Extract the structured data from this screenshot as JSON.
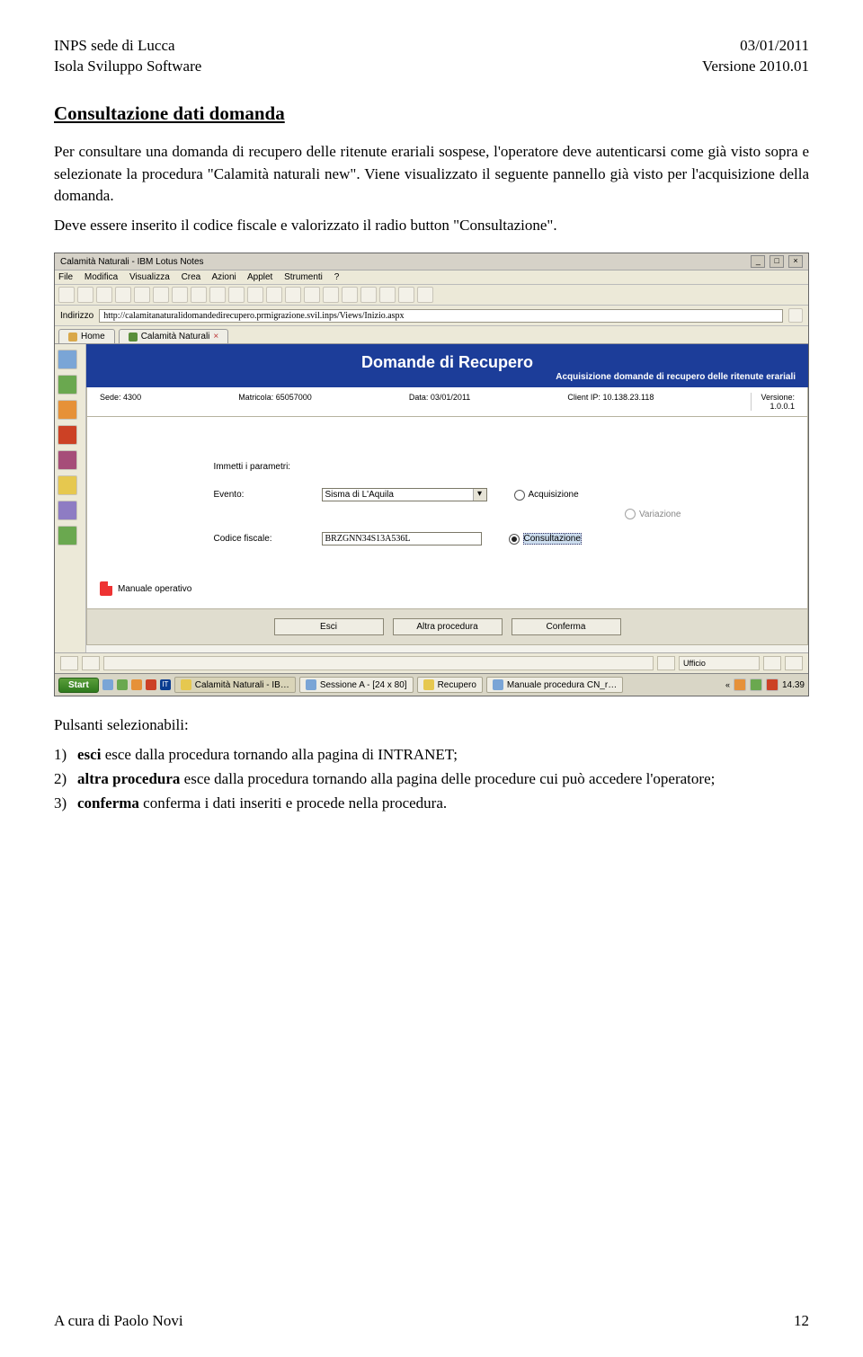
{
  "header": {
    "left1": "INPS sede di Lucca",
    "left2": "Isola Sviluppo Software",
    "right1": "03/01/2011",
    "right2": "Versione 2010.01"
  },
  "title": "Consultazione dati domanda",
  "para1": "Per consultare una domanda di recupero delle ritenute erariali sospese, l'operatore deve autenticarsi come già visto sopra e selezionate la procedura \"Calamità naturali new\". Viene visualizzato il seguente pannello già visto per l'acquisizione della domanda.",
  "para2": "Deve essere inserito il codice fiscale e valorizzato il radio button \"Consultazione\".",
  "lotus": {
    "title": "Calamità Naturali - IBM Lotus Notes",
    "menu": [
      "File",
      "Modifica",
      "Visualizza",
      "Crea",
      "Azioni",
      "Applet",
      "Strumenti",
      "?"
    ],
    "addr_label": "Indirizzo",
    "addr_value": "http://calamitanaturalidomandedirecupero.prmigrazione.svil.inps/Views/Inizio.aspx",
    "tabs": {
      "home": "Home",
      "main": "Calamità Naturali"
    },
    "banner_title": "Domande di Recupero",
    "banner_sub": "Acquisizione domande di recupero delle ritenute erariali",
    "info": {
      "sede_l": "Sede:",
      "sede_v": "4300",
      "matr_l": "Matricola:",
      "matr_v": "65057000",
      "data_l": "Data:",
      "data_v": "03/01/2011",
      "ip_l": "Client IP:",
      "ip_v": "10.138.23.118",
      "ver_l": "Versione:",
      "ver_v": "1.0.0.1"
    },
    "form": {
      "prompt": "Immetti i parametri:",
      "evento_l": "Evento:",
      "evento_v": "Sisma di L'Aquila",
      "cf_l": "Codice fiscale:",
      "cf_v": "BRZGNN34S13A536L",
      "r1": "Acquisizione",
      "r2": "Variazione",
      "r3": "Consultazione"
    },
    "manual": "Manuale operativo",
    "buttons": {
      "b1": "Esci",
      "b2": "Altra procedura",
      "b3": "Conferma"
    },
    "status_ufficio": "Ufficio"
  },
  "taskbar": {
    "start": "Start",
    "items": [
      "Calamità Naturali - IB…",
      "Sessione A - [24 x 80]",
      "Recupero",
      "Manuale procedura CN_r…"
    ],
    "time": "14.39"
  },
  "after": {
    "intro": "Pulsanti selezionabili:",
    "rows": [
      {
        "n": "1)",
        "b": "esci",
        "t": " esce dalla procedura tornando alla pagina di INTRANET;"
      },
      {
        "n": "2)",
        "b": "altra procedura",
        "t": " esce dalla procedura tornando alla pagina delle procedure cui può accedere l'operatore;"
      },
      {
        "n": "3)",
        "b": "conferma",
        "t": " conferma i dati inseriti e procede nella procedura."
      }
    ]
  },
  "footer": {
    "left": "A cura di Paolo Novi",
    "page": "12"
  }
}
